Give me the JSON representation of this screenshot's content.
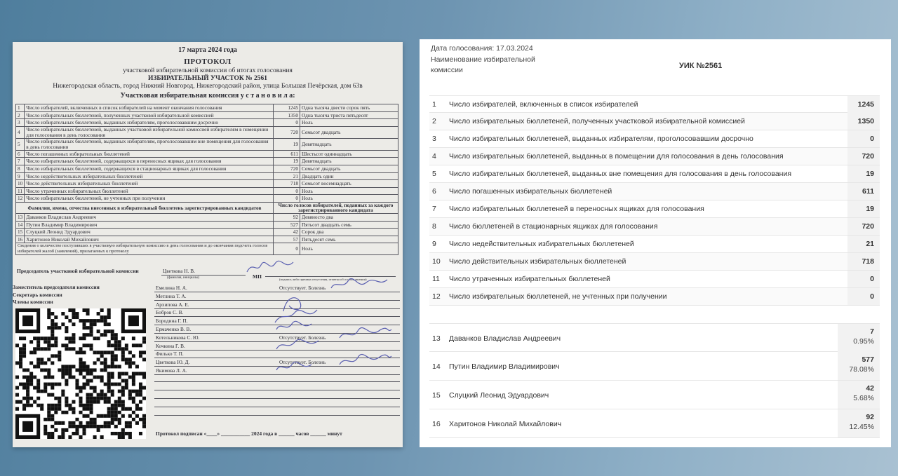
{
  "paper": {
    "date": "17 марта 2024 года",
    "title": "ПРОТОКОЛ",
    "subtitle": "участковой избирательной комиссии об итогах голосования",
    "district": "ИЗБИРАТЕЛЬНЫЙ УЧАСТОК № 2561",
    "address": "Нижегородская область, город Нижний Новгород, Нижегородский район, улица Большая Печёрская, дом 63в",
    "established": "Участковая избирательная комиссия у с т а н о в и л а:",
    "rows": [
      {
        "num": "1",
        "label": "Число избирателей, включенных в список избирателей на момент окончания голосования",
        "value": "1245",
        "words": "Одна тысяча двести сорок пять"
      },
      {
        "num": "2",
        "label": "Число избирательных бюллетеней, полученных участковой избирательной комиссией",
        "value": "1350",
        "words": "Одна тысяча триста пятьдесят"
      },
      {
        "num": "3",
        "label": "Число избирательных бюллетеней, выданных избирателям, проголосовавшим досрочно",
        "value": "0",
        "words": "Ноль"
      },
      {
        "num": "4",
        "label": "Число избирательных бюллетеней, выданных участковой избирательной комиссией избирателям в помещении для голосования в день голосования",
        "value": "720",
        "words": "Семьсот двадцать"
      },
      {
        "num": "5",
        "label": "Число избирательных бюллетеней, выданных избирателям, проголосовавшим вне помещения для голосования в день голосования",
        "value": "19",
        "words": "Девятнадцать"
      },
      {
        "num": "6",
        "label": "Число погашенных избирательных бюллетеней",
        "value": "611",
        "words": "Шестьсот одиннадцать"
      },
      {
        "num": "7",
        "label": "Число избирательных бюллетеней, содержащихся в переносных ящиках для голосования",
        "value": "19",
        "words": "Девятнадцать"
      },
      {
        "num": "8",
        "label": "Число избирательных бюллетеней, содержащихся в стационарных ящиках для голосования",
        "value": "720",
        "words": "Семьсот двадцать"
      },
      {
        "num": "9",
        "label": "Число недействительных избирательных бюллетеней",
        "value": "21",
        "words": "Двадцать один"
      },
      {
        "num": "10",
        "label": "Число действительных избирательных бюллетеней",
        "value": "718",
        "words": "Семьсот восемнадцать"
      },
      {
        "num": "11",
        "label": "Число утраченных избирательных бюллетеней",
        "value": "0",
        "words": "Ноль"
      },
      {
        "num": "12",
        "label": "Число избирательных бюллетеней, не учтенных при получении",
        "value": "0",
        "words": "Ноль"
      }
    ],
    "cand_head_left": "Фамилии, имена, отчества внесенных в избирательный бюллетень зарегистрированных кандидатов",
    "cand_head_right": "Число голосов избирателей, поданных за каждого зарегистрированного кандидата",
    "candidates": [
      {
        "num": "13",
        "name": "Даванков Владислав Андреевич",
        "value": "92",
        "words": "Девяносто два"
      },
      {
        "num": "14",
        "name": "Путин Владимир Владимирович",
        "value": "527",
        "words": "Пятьсот двадцать семь"
      },
      {
        "num": "15",
        "name": "Слуцкий Леонид Эдуардович",
        "value": "42",
        "words": "Сорок два"
      },
      {
        "num": "16",
        "name": "Харитонов Николай Михайлович",
        "value": "57",
        "words": "Пятьдесят семь"
      }
    ],
    "complaints_label": "Сведения о количестве поступивших в участковую избирательную комиссию в день голосования и до окончания подсчета голосов избирателей жалоб (заявлений), прилагаемых к протоколу",
    "complaints_value": "0",
    "complaints_words": "Ноль",
    "chair_label": "Председатель участковой избирательной комиссии",
    "chair_name": "Цветкова Н. В.",
    "chair_hint": "(фамилия, инициалы)",
    "mp": "МП",
    "sign_hint": "(подпись либо причина отсутствия, отметка об особом мнении)",
    "deputy_label": "Заместитель председателя комиссии",
    "secretary_label": "Секретарь комиссии",
    "members_label": "Члены комиссии",
    "members": [
      {
        "name": "Емелина Н. А.",
        "note": "Отсутствует. Болезнь"
      },
      {
        "name": "Метлина Т. А.",
        "note": ""
      },
      {
        "name": "Архипова А. Е.",
        "note": ""
      },
      {
        "name": "Бобров С. В.",
        "note": ""
      },
      {
        "name": "Бородина Г. П.",
        "note": ""
      },
      {
        "name": "Ермаченко В. В.",
        "note": ""
      },
      {
        "name": "Котельникова С. Ю.",
        "note": "Отсутствует. Болезнь"
      },
      {
        "name": "Кочкина Г. В.",
        "note": ""
      },
      {
        "name": "Филько Т. П.",
        "note": ""
      },
      {
        "name": "Цветкова Ю. Д.",
        "note": "Отсутствует. Болезнь"
      },
      {
        "name": "Якимова Л. А.",
        "note": ""
      }
    ],
    "signed_line": "Протокол подписан «____» ___________ 2024 года в ______ часов ______ минут"
  },
  "panel": {
    "date_label": "Дата голосования:",
    "date_value": "17.03.2024",
    "name_label": "Наименование избирательной комиссии",
    "uik": "УИК №2561",
    "rows": [
      {
        "num": "1",
        "label": "Число избирателей, включенных в список избирателей",
        "value": "1245"
      },
      {
        "num": "2",
        "label": "Число избирательных бюллетеней, полученных участковой избирательной комиссией",
        "value": "1350"
      },
      {
        "num": "3",
        "label": "Число избирательных бюллетеней, выданных избирателям, проголосовавшим досрочно",
        "value": "0"
      },
      {
        "num": "4",
        "label": "Число избирательных бюллетеней, выданных в помещении для голосования в день голосования",
        "value": "720"
      },
      {
        "num": "5",
        "label": "Число избирательных бюллетеней, выданных вне помещения для голосования в день голосования",
        "value": "19"
      },
      {
        "num": "6",
        "label": "Число погашенных избирательных бюллетеней",
        "value": "611"
      },
      {
        "num": "7",
        "label": "Число избирательных бюллетеней в переносных ящиках для голосования",
        "value": "19"
      },
      {
        "num": "8",
        "label": "Число бюллетеней в стационарных ящиках для голосования",
        "value": "720"
      },
      {
        "num": "9",
        "label": "Число недействительных избирательных бюллетеней",
        "value": "21"
      },
      {
        "num": "10",
        "label": "Число действительных избирательных бюллетеней",
        "value": "718"
      },
      {
        "num": "11",
        "label": "Число утраченных избирательных бюллетеней",
        "value": "0"
      },
      {
        "num": "12",
        "label": "Число избирательных бюллетеней, не учтенных при получении",
        "value": "0"
      }
    ],
    "candidates": [
      {
        "num": "13",
        "name": "Даванков Владислав Андреевич",
        "votes": "7",
        "pct": "0.95%"
      },
      {
        "num": "14",
        "name": "Путин Владимир Владимирович",
        "votes": "577",
        "pct": "78.08%"
      },
      {
        "num": "15",
        "name": "Слуцкий Леонид Эдуардович",
        "votes": "42",
        "pct": "5.68%"
      },
      {
        "num": "16",
        "name": "Харитонов Николай Михайлович",
        "votes": "92",
        "pct": "12.45%"
      }
    ]
  }
}
